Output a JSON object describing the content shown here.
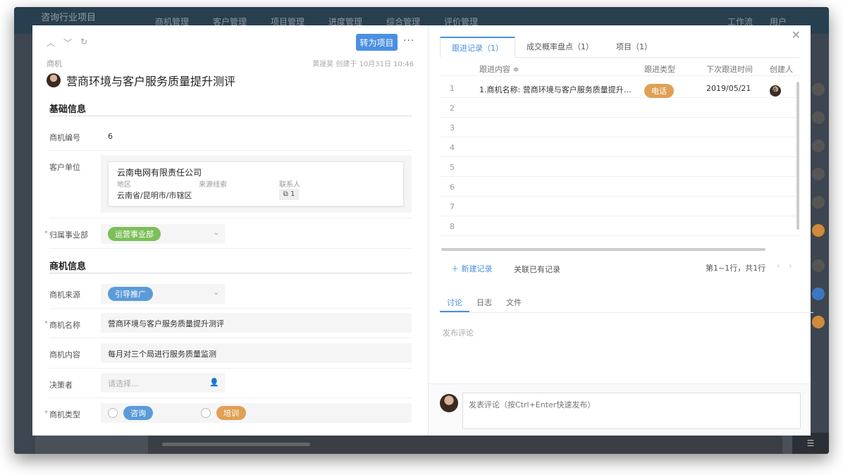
{
  "background": {
    "app_title": "咨询行业项目",
    "nav": [
      "商机管理",
      "客户管理",
      "项目管理",
      "进度管理",
      "综合管理",
      "评价管理"
    ],
    "right_nav": [
      "工作流",
      "用户"
    ]
  },
  "left": {
    "convert_button": "转为项目",
    "more_label": "···",
    "breadcrumb": "商机",
    "meta": "黄晟昊 创建于 10月31日 10:46",
    "title": "营商环境与客户服务质量提升测评",
    "section_basic": "基础信息",
    "section_opportunity": "商机信息",
    "fields": {
      "number_label": "商机编号",
      "number_value": "6",
      "customer_label": "客户单位",
      "customer_name": "云南电网有限责任公司",
      "region_label": "地区",
      "region_value": "云南省/昆明市/市辖区",
      "source_clue_label": "来源线索",
      "contact_label": "联系人",
      "contact_count": "1",
      "department_label": "归属事业部",
      "department_value": "运营事业部",
      "source_label": "商机来源",
      "source_value": "引导推广",
      "name_label": "商机名称",
      "name_value": "营商环境与客户服务质量提升测评",
      "content_label": "商机内容",
      "content_value": "每月对三个局进行服务质量监测",
      "decision_label": "决策者",
      "decision_placeholder": "请选择...",
      "type_label": "商机类型",
      "type_option_1": "咨询",
      "type_option_2": "培训"
    },
    "required_mark": "*"
  },
  "right": {
    "tabs": [
      "跟进记录（1）",
      "成交概率盘点（1）",
      "项目（1）"
    ],
    "table_headers": {
      "content": "跟进内容 ≑",
      "type": "跟进类型",
      "next_time": "下次跟进时间",
      "creator": "创建人"
    },
    "rows": [
      {
        "idx": "1",
        "content": "1.商机名称:  营商环境与客户服务质量提升测...",
        "type": "电话",
        "date": "2019/05/21",
        "creator": "黄"
      },
      {
        "idx": "2"
      },
      {
        "idx": "3"
      },
      {
        "idx": "4"
      },
      {
        "idx": "5"
      },
      {
        "idx": "6"
      },
      {
        "idx": "7"
      },
      {
        "idx": "8"
      }
    ],
    "new_record": "＋ 新建记录",
    "link_existing": "关联已有记录",
    "pager": "第1~1行，共1行",
    "sub_tabs": [
      "讨论",
      "日志",
      "文件"
    ],
    "post_hint": "发布评论",
    "comment_placeholder": "发表评论（按Ctrl+Enter快速发布）"
  },
  "colors": {
    "primary": "#4a90e2",
    "tag_green": "#7cbf5a",
    "tag_blue": "#5b9bd9",
    "tag_orange": "#e0a055"
  }
}
